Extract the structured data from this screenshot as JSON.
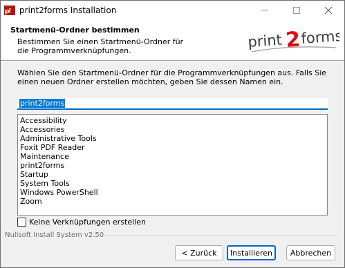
{
  "window": {
    "title": "print2forms Installation"
  },
  "header": {
    "title": "Startmenü-Ordner bestimmen",
    "subtitle": "Bestimmen Sie einen Startmenü-Ordner für die Programmverknüpfungen.",
    "logo": {
      "part1": "print",
      "part2": "2",
      "part3": "forms",
      "accent": "#e30613"
    }
  },
  "body": {
    "description": "Wählen Sie den Startmenü-Ordner für die Programmverknüpfungen aus. Falls Sie einen neuen Ordner erstellen möchten, geben Sie dessen Namen ein.",
    "folder_value": "print2forms",
    "folders": [
      "Accessibility",
      "Accessories",
      "Administrative Tools",
      "Foxit PDF Reader",
      "Maintenance",
      "print2forms",
      "Startup",
      "System Tools",
      "Windows PowerShell",
      "Zoom"
    ],
    "no_shortcuts_label": "Keine Verknüpfungen erstellen"
  },
  "footer": {
    "branding": "Nullsoft Install System v2.50",
    "back_label": "< Zurück",
    "install_label": "Installieren",
    "cancel_label": "Abbrechen"
  }
}
